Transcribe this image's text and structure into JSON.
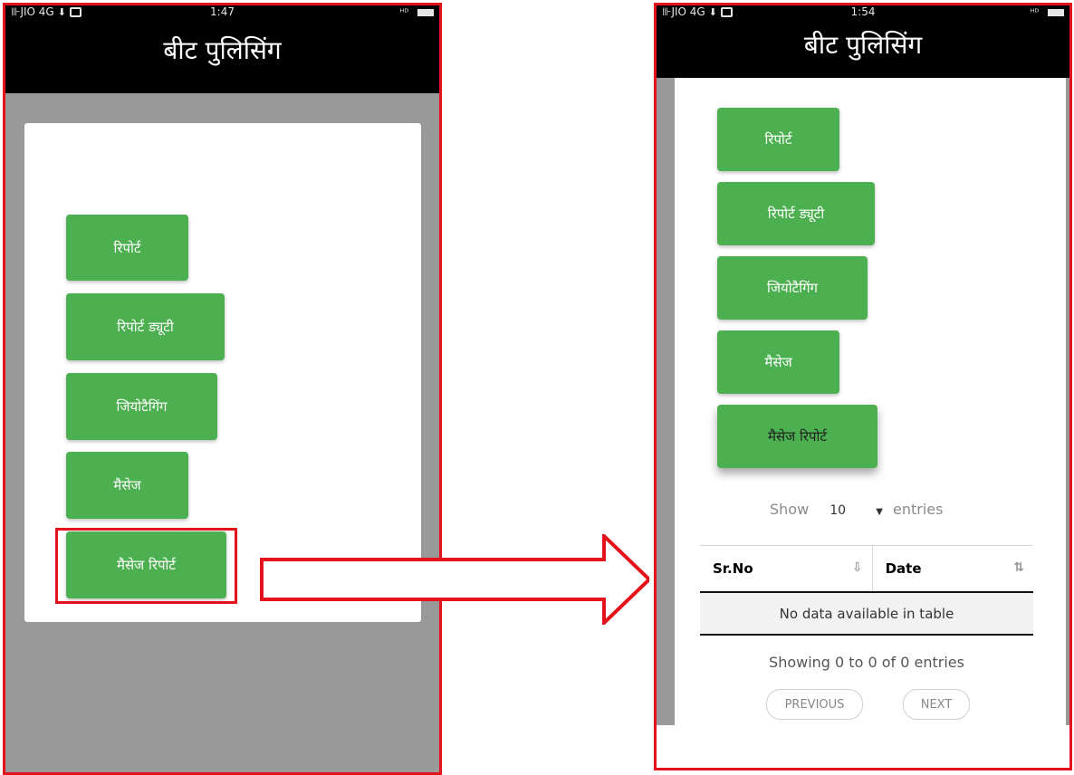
{
  "colors": {
    "accent_green": "#4caf50",
    "highlight_red": "#e3121b",
    "header_black": "#000000"
  },
  "left_screen": {
    "status": {
      "carrier": "JIO 4G",
      "time": "1:47"
    },
    "title": "बीट पुलिसिंग",
    "menu": [
      "रिपोर्ट",
      "रिपोर्ट ड्यूटी",
      "जियोटैगिंग",
      "मैसेज",
      "मैसेज रिपोर्ट"
    ]
  },
  "right_screen": {
    "status": {
      "carrier": "JIO 4G",
      "time": "1:54"
    },
    "title": "बीट पुलिसिंग",
    "menu": [
      "रिपोर्ट",
      "रिपोर्ट ड्यूटी",
      "जियोटैगिंग",
      "मैसेज",
      "मैसेज रिपोर्ट"
    ],
    "table": {
      "show_label": "Show",
      "entries_value": "10",
      "entries_label": "entries",
      "columns": [
        "Sr.No",
        "Date"
      ],
      "empty_message": "No data available in table",
      "info": "Showing 0 to 0 of 0 entries",
      "prev_label": "PREVIOUS",
      "next_label": "NEXT"
    }
  },
  "icons": [
    "signal-icon",
    "download-icon",
    "camera-icon",
    "hd-call-icon",
    "battery-icon",
    "sort-icon",
    "dropdown-caret-icon",
    "arrow-right-icon"
  ]
}
